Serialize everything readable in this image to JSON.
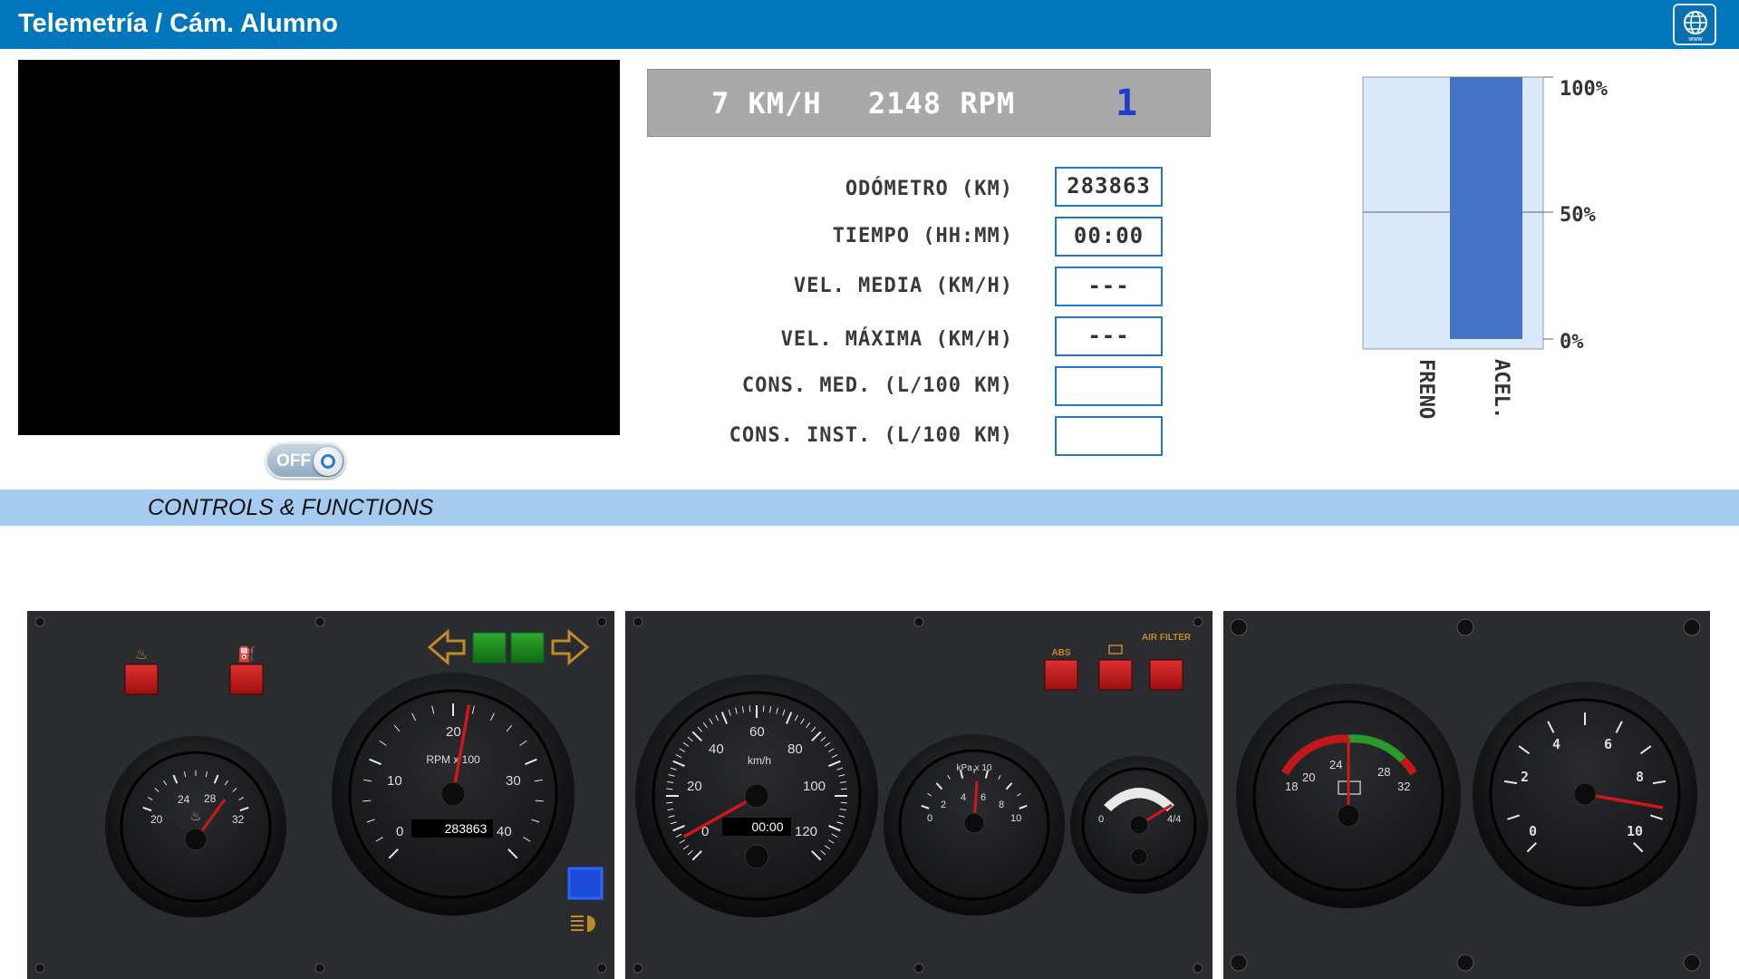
{
  "header": {
    "title": "Telemetría / Cám. Alumno",
    "web_label": "www"
  },
  "camera": {
    "toggle_label": "OFF"
  },
  "speedbar": {
    "speed": "7 KM/H",
    "rpm": "2148 RPM",
    "gear": "1"
  },
  "stats": [
    {
      "label": "ODÓMETRO (KM)",
      "value": "283863"
    },
    {
      "label": "TIEMPO (HH:MM)",
      "value": "00:00"
    },
    {
      "label": "VEL. MEDIA (KM/H)",
      "value": "---"
    },
    {
      "label": "VEL. MÁXIMA (KM/H)",
      "value": "---"
    },
    {
      "label": "CONS. MED. (L/100 KM)",
      "value": ""
    },
    {
      "label": "CONS. INST. (L/100 KM)",
      "value": ""
    }
  ],
  "pedals": {
    "type": "bar",
    "categories": [
      "FRENO",
      "ACEL."
    ],
    "values": [
      0,
      100
    ],
    "ylim": [
      0,
      100
    ],
    "yticks": [
      "100%",
      "50%",
      "0%"
    ],
    "colors": {
      "bar": "#4472c4",
      "bg": "#dae8fb"
    }
  },
  "controls": {
    "title": "CONTROLS & FUNCTIONS"
  },
  "dashboard": {
    "panel1": {
      "temp_gauge": {
        "ticks": [
          "20",
          "24",
          "28",
          "32"
        ],
        "icon": "coolant-temp-icon"
      },
      "rpm_gauge": {
        "label": "RPM x 100",
        "ticks": [
          "0",
          "10",
          "20",
          "30",
          "40"
        ],
        "odometer": "283863",
        "value": 21.5
      },
      "warning_lights": [
        "coolant-warning-icon",
        "oil-warning-icon"
      ],
      "turn_signals": [
        "left-arrow-icon",
        "right-arrow-icon"
      ]
    },
    "panel2": {
      "speed_gauge": {
        "label": "km/h",
        "ticks": [
          "0",
          "20",
          "40",
          "60",
          "80",
          "100",
          "120"
        ],
        "clock": "00:00",
        "value": 7
      },
      "pressure_gauge": {
        "label": "kPa x 10",
        "ticks": [
          "0",
          "2",
          "4",
          "6",
          "8",
          "10"
        ]
      },
      "fuel_gauge": {
        "ticks": [
          "0",
          "4/4"
        ]
      },
      "warning_lights": [
        {
          "label": "ABS"
        },
        {
          "label": ""
        },
        {
          "label": "AIR FILTER"
        }
      ]
    },
    "panel3": {
      "voltage_gauge": {
        "ticks": [
          "18",
          "20",
          "24",
          "28",
          "32"
        ]
      },
      "aux_gauge": {
        "ticks": [
          "0",
          "2",
          "4",
          "6",
          "8",
          "10"
        ]
      }
    }
  }
}
